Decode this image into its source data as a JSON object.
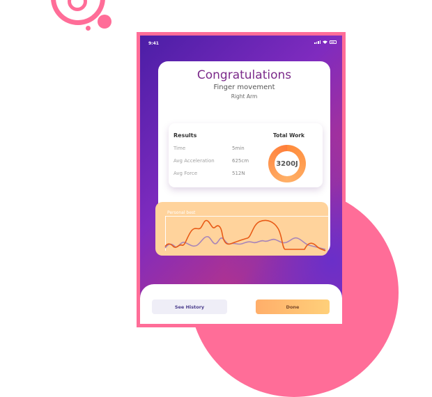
{
  "status": {
    "time": "9:41"
  },
  "header": {
    "title": "Congratulations",
    "exercise": "Finger movement",
    "limb": "Right Arm"
  },
  "results": {
    "title": "Results",
    "metrics": [
      {
        "label": "Time",
        "value": "5min"
      },
      {
        "label": "Avg Acceleration",
        "value": "625cm"
      },
      {
        "label": "Avg Force",
        "value": "512N"
      }
    ],
    "total_title": "Total Work",
    "total_value": "3200J"
  },
  "chart": {
    "label": "Personal best"
  },
  "actions": {
    "history_label": "See History",
    "done_label": "Done"
  },
  "colors": {
    "accent": "#ff6d98",
    "title": "#7b2a8a",
    "orange_line": "#e85a16",
    "purple_line": "#a885b8"
  }
}
